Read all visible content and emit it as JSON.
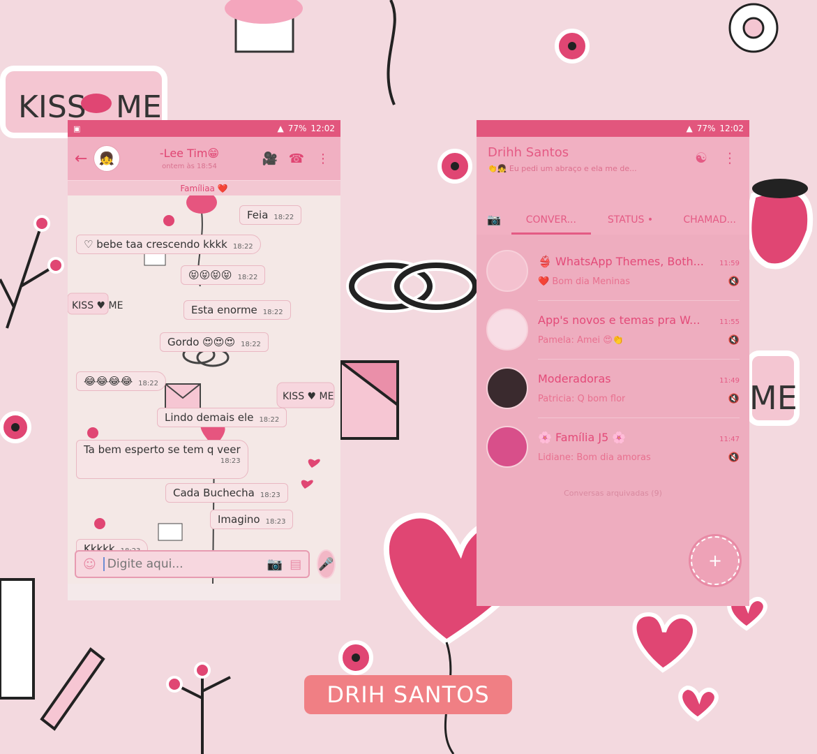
{
  "watermark": "DRIH SANTOS",
  "background": {
    "sticker_text_1": "KISS",
    "sticker_text_2": "ME"
  },
  "chat": {
    "status_bar": {
      "battery": "77%",
      "time": "12:02"
    },
    "header": {
      "contact_name": "-Lee Tim😁",
      "last_seen": "ontem às 18:54",
      "group_label": "Famíliaa ❤️"
    },
    "messages": [
      {
        "text": "Feia",
        "time": "18:22",
        "dir": "out"
      },
      {
        "text": "♡ bebe taa crescendo kkkk",
        "time": "18:22",
        "dir": "in"
      },
      {
        "text": "😝😝😝😝",
        "time": "18:22",
        "dir": "out"
      },
      {
        "text": "Esta enorme",
        "time": "18:22",
        "dir": "out"
      },
      {
        "text": "Gordo 😍😍😍",
        "time": "18:22",
        "dir": "out"
      },
      {
        "text": "😂😂😂😂",
        "time": "18:22",
        "dir": "in"
      },
      {
        "text": "Lindo demais ele",
        "time": "18:22",
        "dir": "out"
      },
      {
        "text": "Ta bem esperto se tem q veer",
        "time": "18:23",
        "dir": "in"
      },
      {
        "text": "Cada Buchecha",
        "time": "18:23",
        "dir": "out"
      },
      {
        "text": "Imagino",
        "time": "18:23",
        "dir": "out"
      },
      {
        "text": "Kkkkk",
        "time": "18:23",
        "dir": "in"
      }
    ],
    "input_placeholder": "Digite aqui..."
  },
  "list": {
    "status_bar": {
      "battery": "77%",
      "time": "12:02"
    },
    "owner_name": "Drihh Santos",
    "owner_status": "👏👧 Eu pedi um abraço e ela me de...",
    "tabs": [
      "CONVER...",
      "STATUS •",
      "CHAMAD..."
    ],
    "conversations": [
      {
        "name": "👙 WhatsApp Themes, Both...",
        "time": "11:59",
        "message": "❤️ Bom dia Meninas",
        "avatar_color": "#f4c1cf"
      },
      {
        "name": "App's novos e temas pra W...",
        "time": "11:55",
        "message": "Pamela: Amei 😍👏",
        "avatar_color": "#f8dde5"
      },
      {
        "name": "Moderadoras",
        "time": "11:49",
        "message": "Patricia: Q bom flor",
        "avatar_color": "#3a2a2e"
      },
      {
        "name": "🌸 Família J5 🌸",
        "time": "11:47",
        "message": "Lidiane: Bom dia amoras",
        "avatar_color": "#d84f8a"
      }
    ],
    "archived": "Conversas arquivadas (9)",
    "fab_label": "+"
  }
}
